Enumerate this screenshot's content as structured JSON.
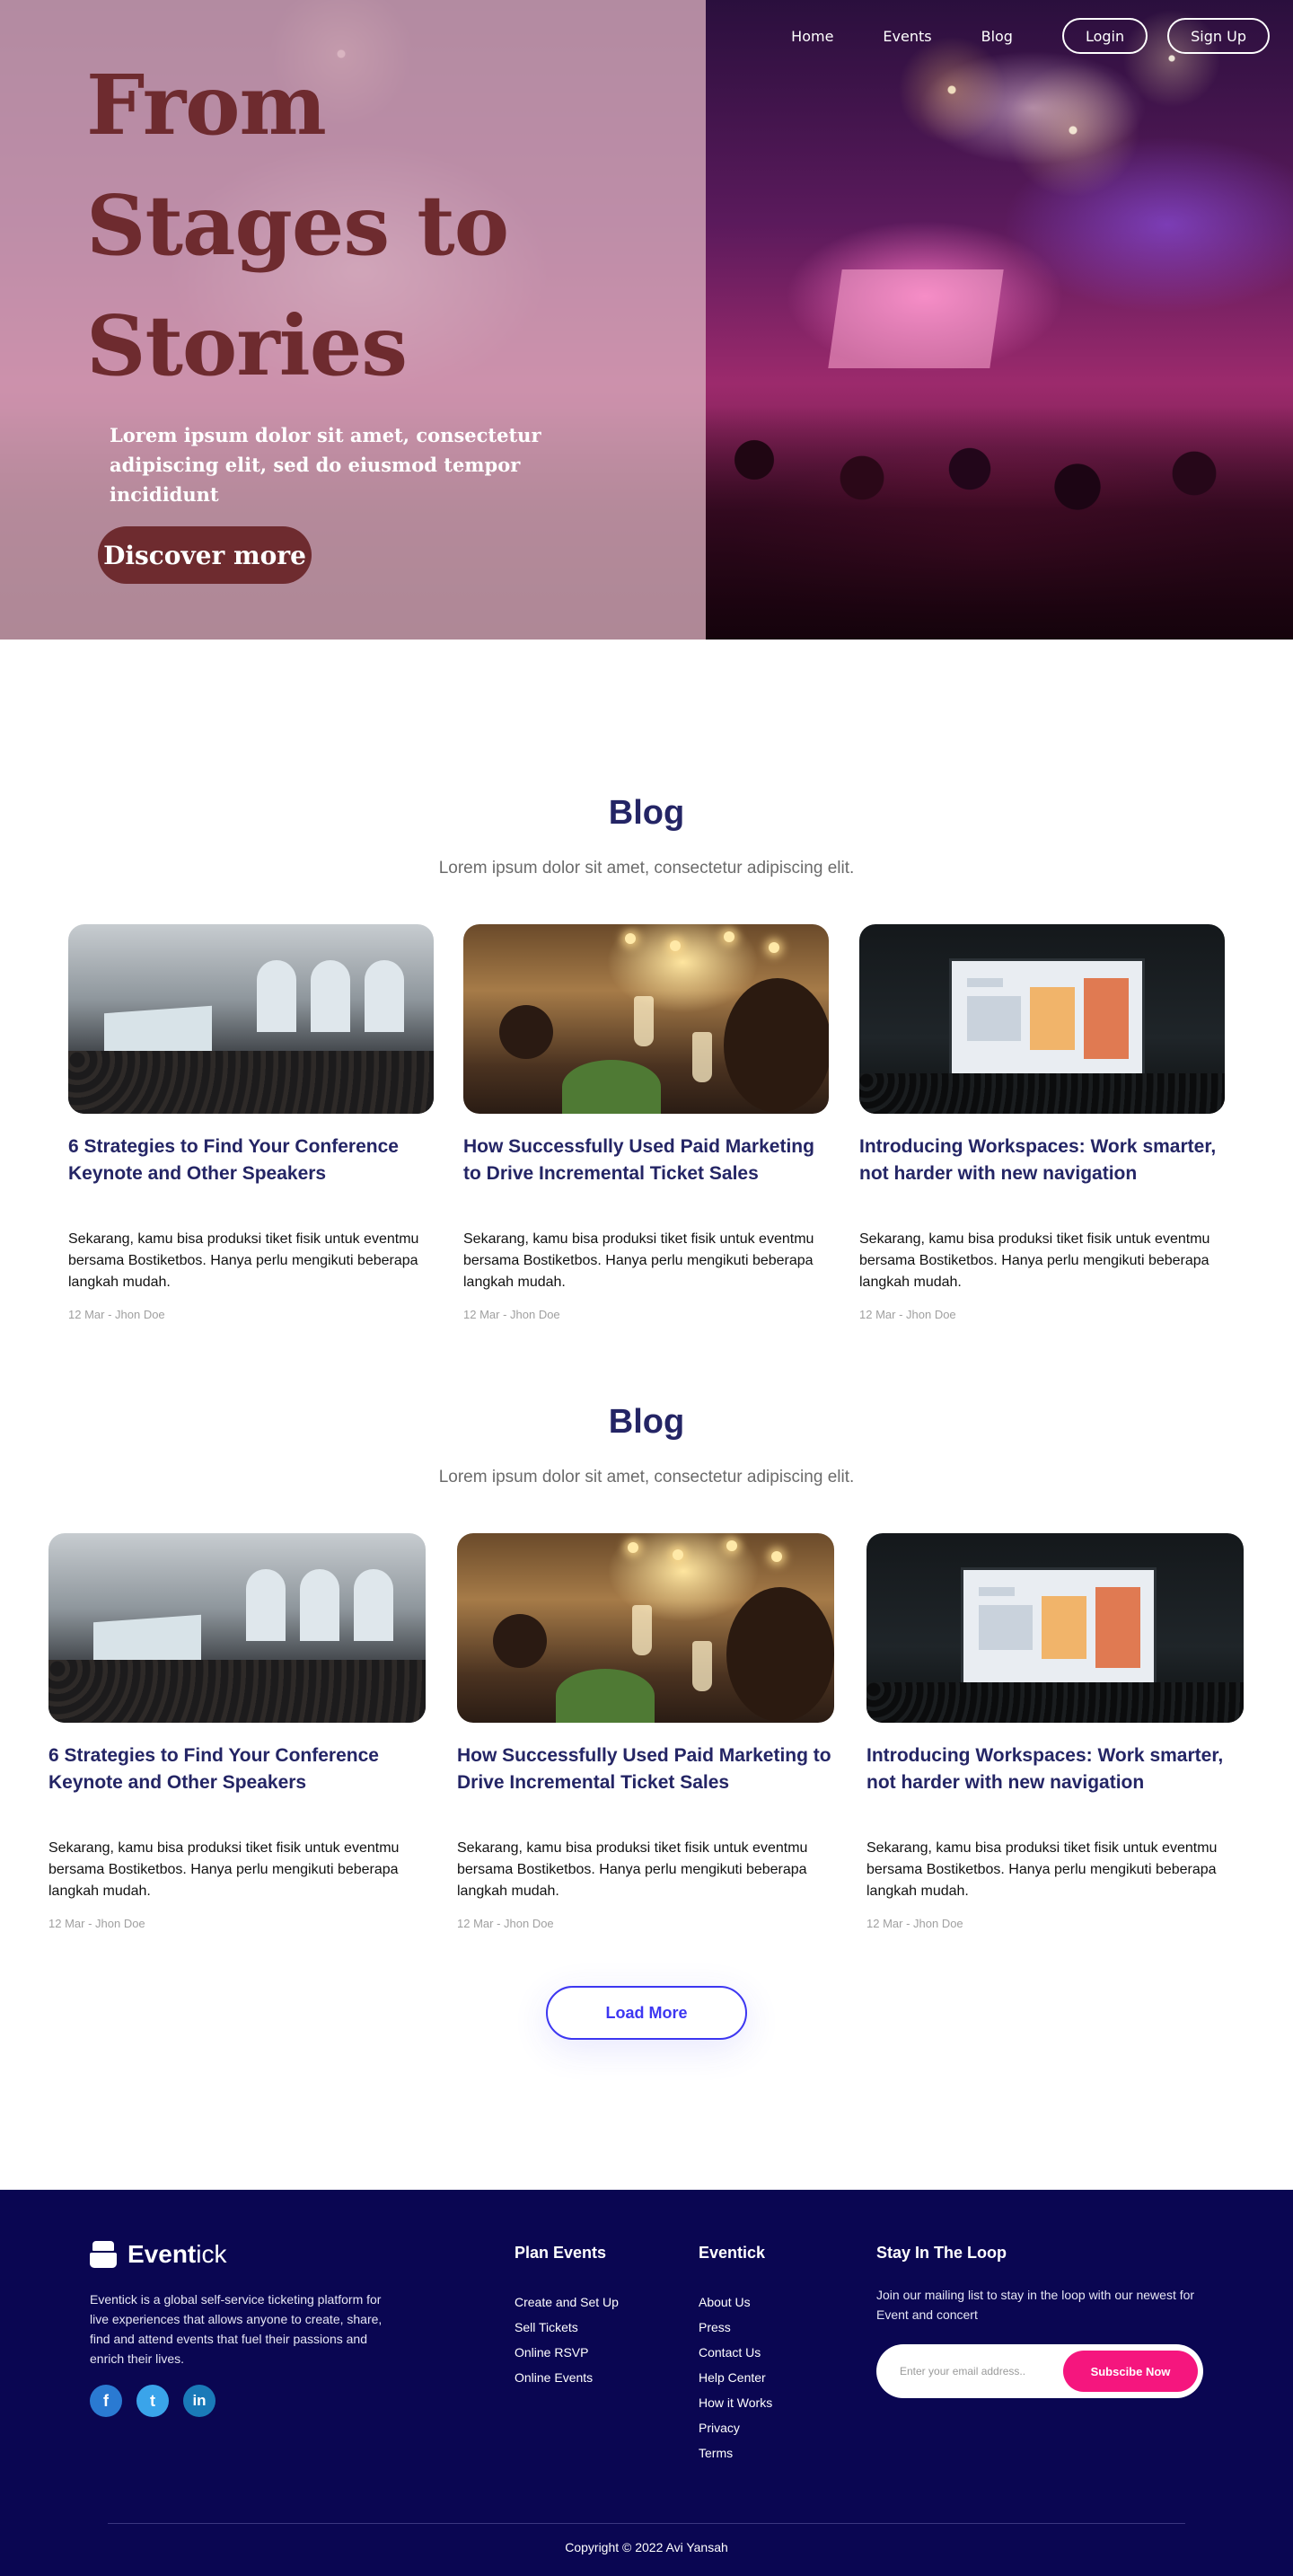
{
  "nav": {
    "links": [
      "Home",
      "Events",
      "Blog"
    ],
    "login_label": "Login",
    "signup_label": "Sign Up"
  },
  "hero": {
    "title": "From Stages to Stories",
    "subtitle": "Lorem ipsum dolor sit amet, consectetur adipiscing elit, sed do eiusmod tempor incididunt",
    "cta_label": "Discover more"
  },
  "blog_sections": [
    {
      "title": "Blog",
      "subtitle": "Lorem ipsum dolor sit amet, consectetur adipiscing elit.",
      "posts": [
        {
          "title": "6 Strategies to Find Your Conference Keynote and Other Speakers",
          "excerpt": "Sekarang, kamu bisa produksi tiket fisik untuk eventmu bersama Bostiketbos. Hanya perlu mengikuti beberapa langkah mudah.",
          "meta": "12 Mar - Jhon Doe"
        },
        {
          "title": "How Successfully Used Paid Marketing to Drive Incremental Ticket Sales",
          "excerpt": "Sekarang, kamu bisa produksi tiket fisik untuk eventmu bersama Bostiketbos. Hanya perlu mengikuti beberapa langkah mudah.",
          "meta": "12 Mar - Jhon Doe"
        },
        {
          "title": "Introducing Workspaces: Work smarter, not harder with new navigation",
          "excerpt": "Sekarang, kamu bisa produksi tiket fisik untuk eventmu bersama Bostiketbos. Hanya perlu mengikuti beberapa langkah mudah.",
          "meta": "12 Mar - Jhon Doe"
        }
      ]
    },
    {
      "title": "Blog",
      "subtitle": "Lorem ipsum dolor sit amet, consectetur adipiscing elit.",
      "posts": [
        {
          "title": "6 Strategies to Find Your Conference Keynote and Other Speakers",
          "excerpt": "Sekarang, kamu bisa produksi tiket fisik untuk eventmu bersama Bostiketbos. Hanya perlu mengikuti beberapa langkah mudah.",
          "meta": "12 Mar - Jhon Doe"
        },
        {
          "title": "How Successfully Used Paid Marketing to Drive Incremental Ticket Sales",
          "excerpt": "Sekarang, kamu bisa produksi tiket fisik untuk eventmu bersama Bostiketbos. Hanya perlu mengikuti beberapa langkah mudah.",
          "meta": "12 Mar - Jhon Doe"
        },
        {
          "title": "Introducing Workspaces: Work smarter, not harder with new navigation",
          "excerpt": "Sekarang, kamu bisa produksi tiket fisik untuk eventmu bersama Bostiketbos. Hanya perlu mengikuti beberapa langkah mudah.",
          "meta": "12 Mar - Jhon Doe"
        }
      ]
    }
  ],
  "load_more_label": "Load More",
  "footer": {
    "brand_bold": "Event",
    "brand_light": "ick",
    "about": "Eventick is a global self-service ticketing platform for live experiences that allows anyone to create, share, find and attend events that fuel their passions and enrich their lives.",
    "socials": [
      {
        "icon": "facebook-icon",
        "glyph": "f"
      },
      {
        "icon": "twitter-icon",
        "glyph": "t"
      },
      {
        "icon": "linkedin-icon",
        "glyph": "in"
      }
    ],
    "plan_events": {
      "heading": "Plan Events",
      "links": [
        "Create and Set Up",
        "Sell Tickets",
        "Online RSVP",
        "Online Events"
      ]
    },
    "eventick": {
      "heading": "Eventick",
      "links": [
        "About Us",
        "Press",
        "Contact Us",
        "Help Center",
        "How it Works",
        "Privacy",
        "Terms"
      ]
    },
    "newsletter": {
      "heading": "Stay In The Loop",
      "text": "Join our mailing list to stay in the loop with our newest for Event and concert",
      "placeholder": "Enter your email address..",
      "button_label": "Subscibe Now"
    },
    "copyright": "Copyright © 2022 Avi Yansah"
  },
  "colors": {
    "hero_title": "#6e2b2f",
    "section_title": "#242565",
    "accent_blue": "#3d37f1",
    "footer_bg": "#0a0652",
    "subscribe_pink": "#f5167e"
  }
}
